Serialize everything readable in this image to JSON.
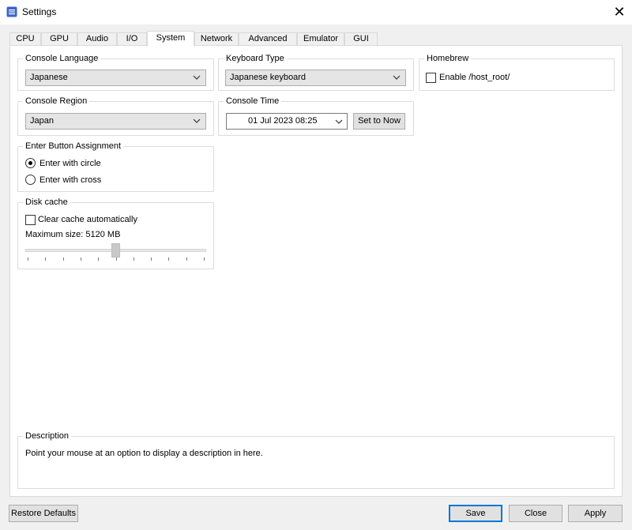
{
  "window": {
    "title": "Settings",
    "close_glyph": "✕"
  },
  "tabs": [
    {
      "label": "CPU"
    },
    {
      "label": "GPU"
    },
    {
      "label": "Audio"
    },
    {
      "label": "I/O"
    },
    {
      "label": "System",
      "active": true
    },
    {
      "label": "Network"
    },
    {
      "label": "Advanced"
    },
    {
      "label": "Emulator"
    },
    {
      "label": "GUI"
    }
  ],
  "console_language": {
    "title": "Console Language",
    "value": "Japanese"
  },
  "keyboard_type": {
    "title": "Keyboard Type",
    "value": "Japanese keyboard"
  },
  "homebrew": {
    "title": "Homebrew",
    "enable_host_root": {
      "label": "Enable /host_root/",
      "checked": false
    }
  },
  "console_region": {
    "title": "Console Region",
    "value": "Japan"
  },
  "console_time": {
    "title": "Console Time",
    "value": "01 Jul 2023 08:25",
    "set_now_label": "Set to Now"
  },
  "enter_button": {
    "title": "Enter Button Assignment",
    "options": [
      {
        "label": "Enter with circle",
        "selected": true
      },
      {
        "label": "Enter with cross",
        "selected": false
      }
    ]
  },
  "disk_cache": {
    "title": "Disk cache",
    "clear_auto": {
      "label": "Clear cache automatically",
      "checked": false
    },
    "max_size_label": "Maximum size: 5120 MB",
    "slider_fraction": 0.5,
    "tick_count": 11
  },
  "description": {
    "title": "Description",
    "text": "Point your mouse at an option to display a description in here."
  },
  "footer": {
    "restore_label": "Restore Defaults",
    "save_label": "Save",
    "close_label": "Close",
    "apply_label": "Apply"
  },
  "colors": {
    "accent": "#0078d7",
    "app_icon": "#3c64c8"
  }
}
